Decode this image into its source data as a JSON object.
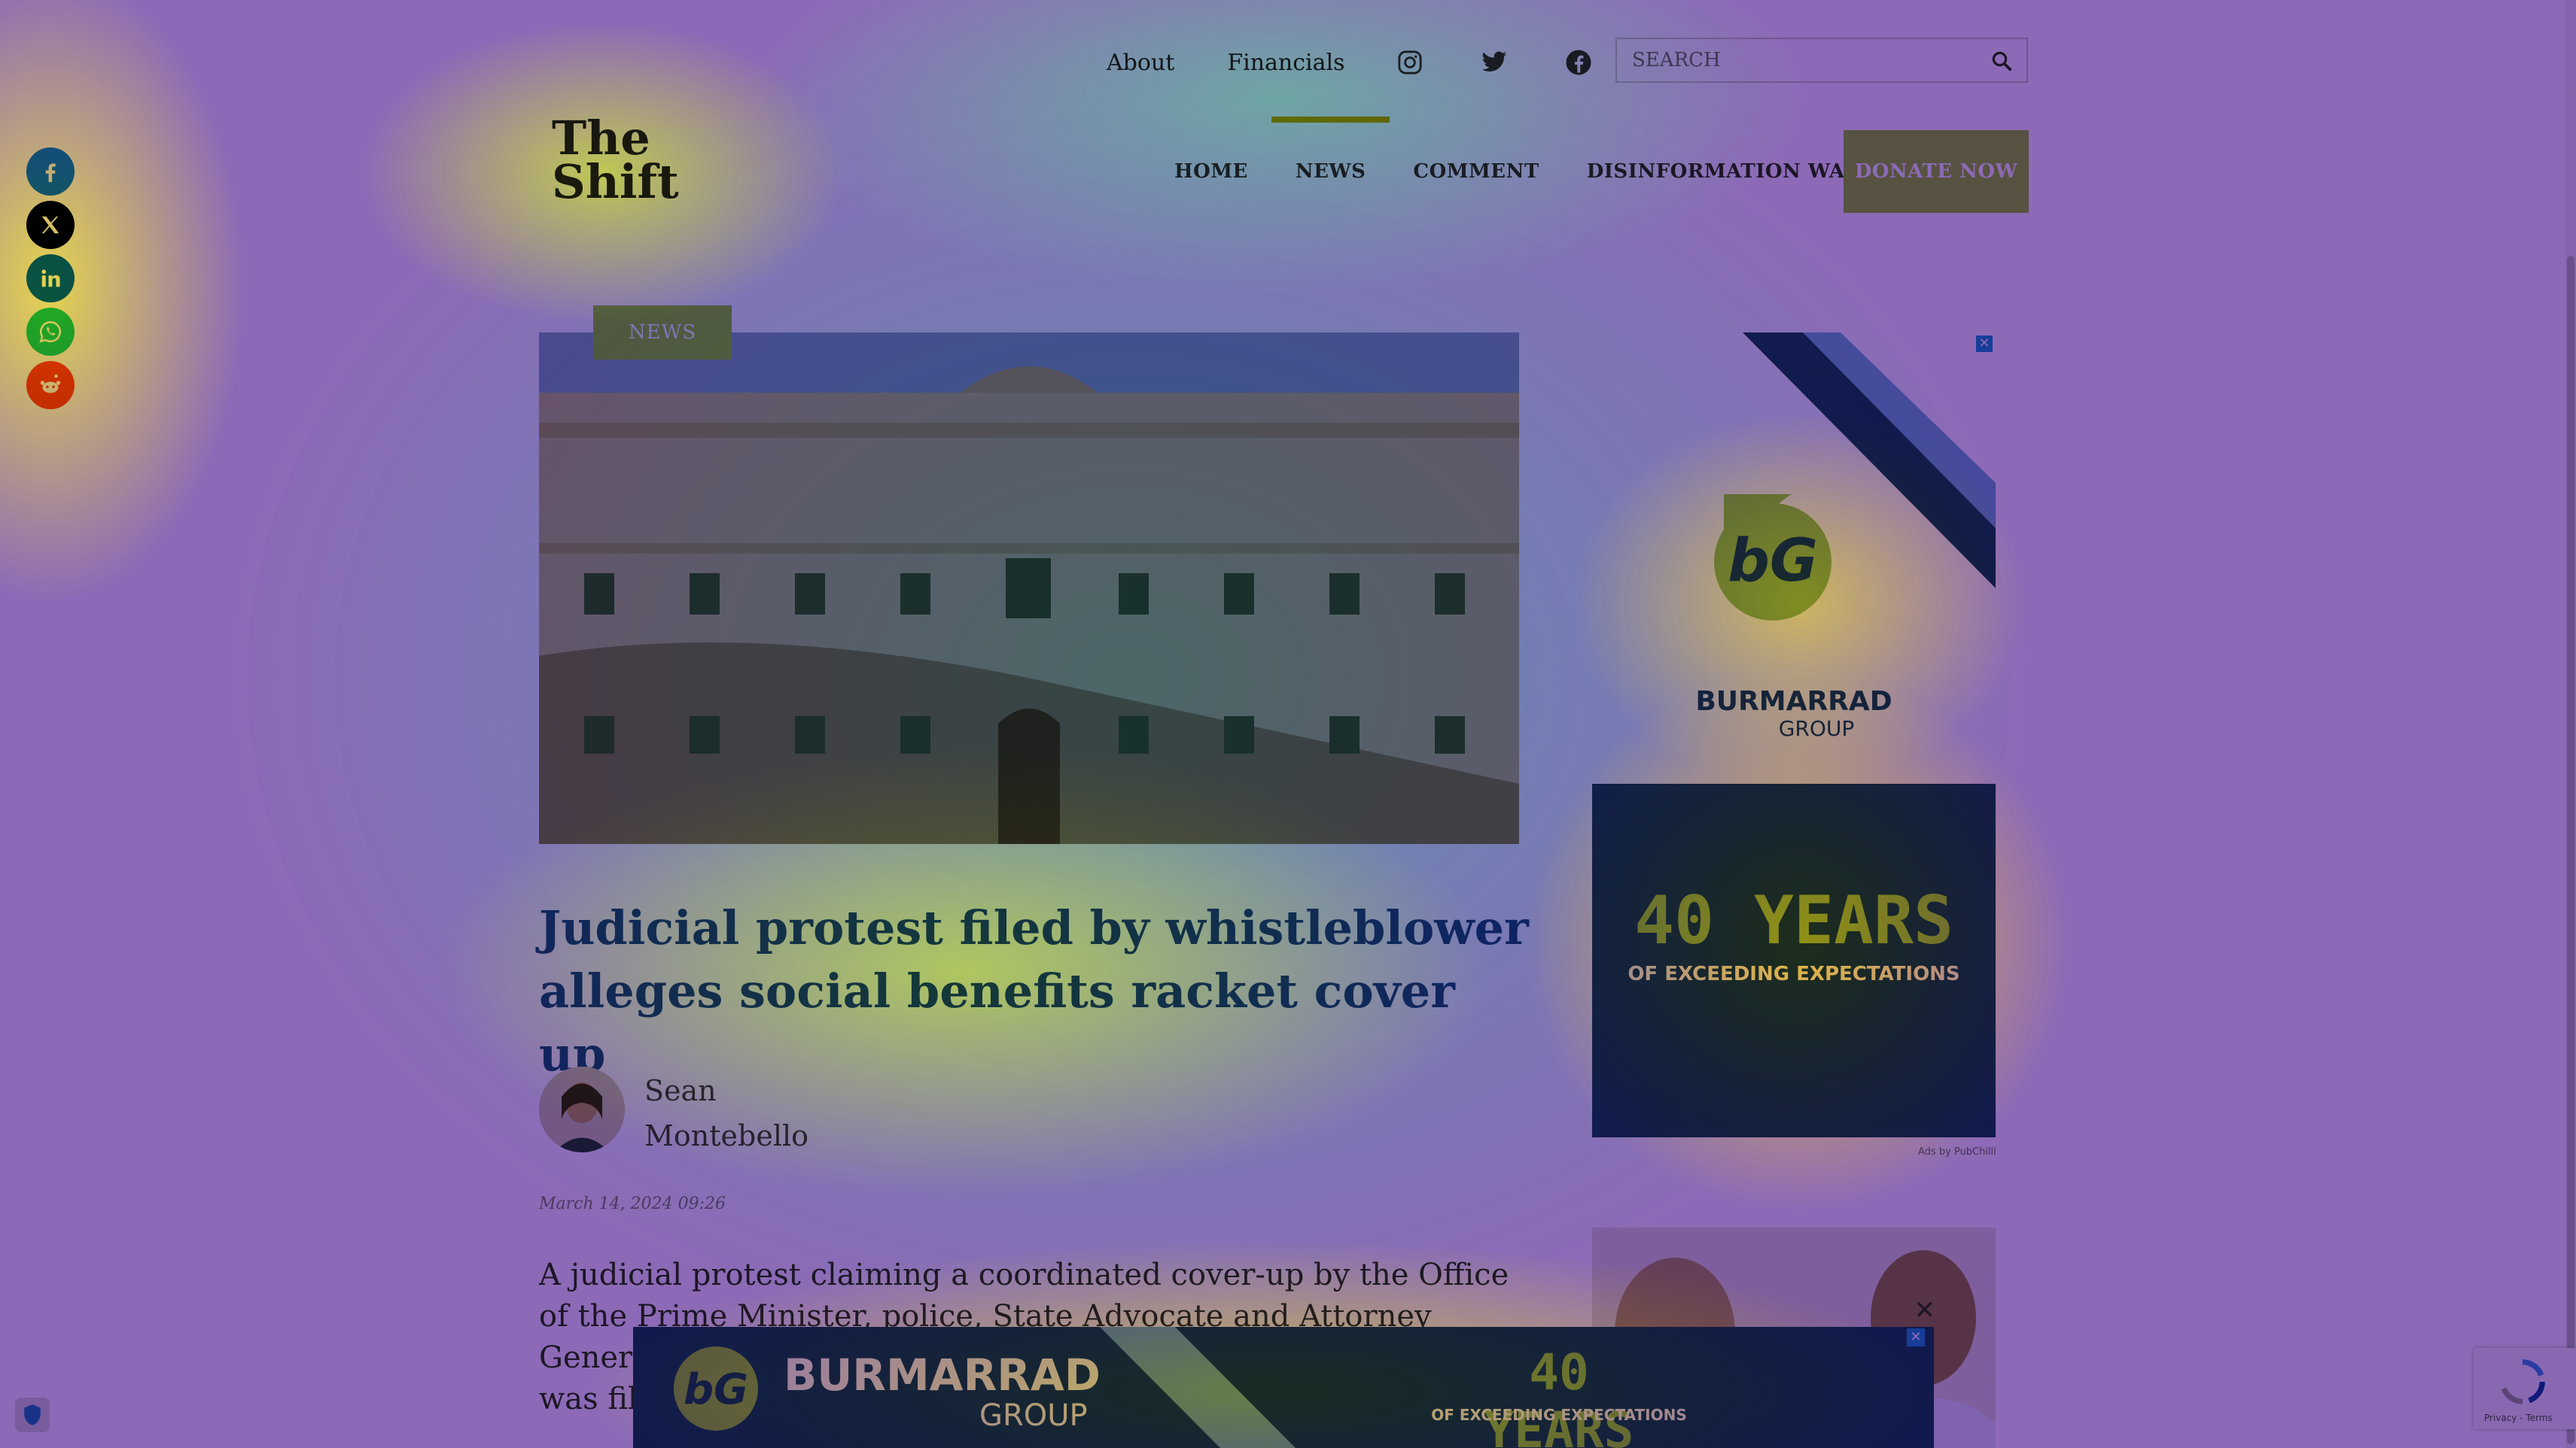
{
  "topbar": {
    "about": "About",
    "financials": "Financials",
    "icons": [
      "instagram-icon",
      "twitter-icon",
      "facebook-icon"
    ],
    "search_placeholder": "SEARCH"
  },
  "logo": {
    "line1": "The",
    "line2": "Shift"
  },
  "nav": {
    "items": [
      "HOME",
      "NEWS",
      "COMMENT",
      "DISINFORMATION WATCH"
    ],
    "active": "NEWS",
    "donate": "DONATE NOW"
  },
  "social": [
    "facebook",
    "x",
    "linkedin",
    "whatsapp",
    "reddit"
  ],
  "article": {
    "category": "NEWS",
    "title": "Judicial protest filed by whistleblower alleges social benefits racket cover up",
    "author_first": "Sean",
    "author_last": "Montebello",
    "date": "March 14, 2024 09:26",
    "body": "A judicial protest claiming a coordinated cover-up by the Office of the Prime Minister, police, State Advocate and Attorney General of fraud",
    "body_tail": "was fil"
  },
  "ads": {
    "brand": "BURMARRAD",
    "brand_sub": "GROUP",
    "years": "40 YEARS",
    "tagline": "OF EXCEEDING EXPECTATIONS",
    "ads_by": "Ads by PubChilli",
    "close": "✕"
  },
  "recaptcha": {
    "text": "Privacy - Terms"
  },
  "colors": {
    "accent": "#9ec65a",
    "title": "#1e4a8c",
    "nav_active": "#d6a800",
    "ad_blue": "#1f3d6b"
  }
}
